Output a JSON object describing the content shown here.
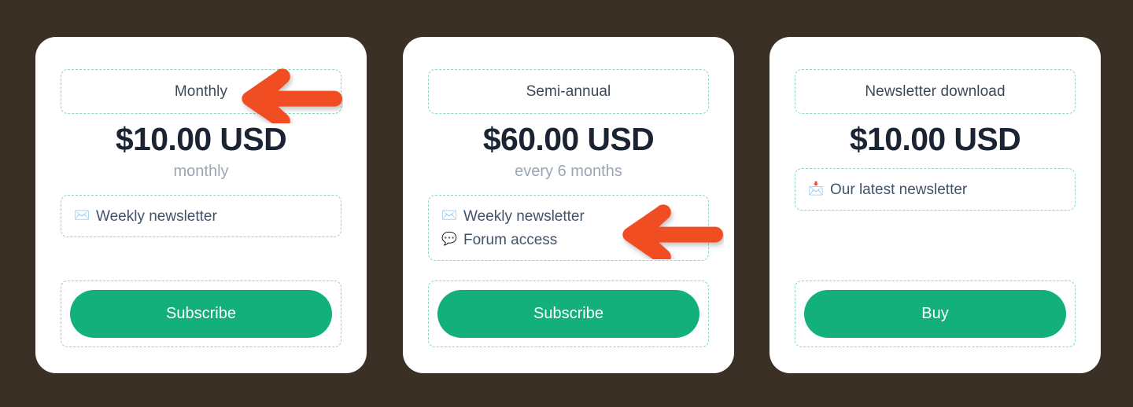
{
  "page": {
    "background_color": "#3a3026",
    "card_background": "#ffffff",
    "accent_green": "#14b07c",
    "dashed_border_color": "#8ad9bd",
    "annotation_arrow_color": "#f04e23"
  },
  "cards": [
    {
      "plan_title": "Monthly",
      "price": "$10.00 USD",
      "period": "monthly",
      "features": [
        {
          "icon": "envelope-icon",
          "glyph": "✉️",
          "label": "Weekly newsletter"
        }
      ],
      "button_label": "Subscribe"
    },
    {
      "plan_title": "Semi-annual",
      "price": "$60.00 USD",
      "period": "every 6 months",
      "features": [
        {
          "icon": "envelope-icon",
          "glyph": "✉️",
          "label": "Weekly newsletter"
        },
        {
          "icon": "speech-balloon-icon",
          "glyph": "💬",
          "label": "Forum access"
        }
      ],
      "button_label": "Subscribe"
    },
    {
      "plan_title": "Newsletter download",
      "price": "$10.00 USD",
      "period": "",
      "features": [
        {
          "icon": "incoming-envelope-icon",
          "glyph": "📩",
          "label": "Our latest newsletter"
        }
      ],
      "button_label": "Buy"
    }
  ],
  "annotations": [
    {
      "name": "arrow-pointing-to-monthly-title",
      "direction": "left",
      "color": "#f04e23"
    },
    {
      "name": "arrow-pointing-to-semi-annual-features",
      "direction": "left",
      "color": "#f04e23"
    }
  ]
}
